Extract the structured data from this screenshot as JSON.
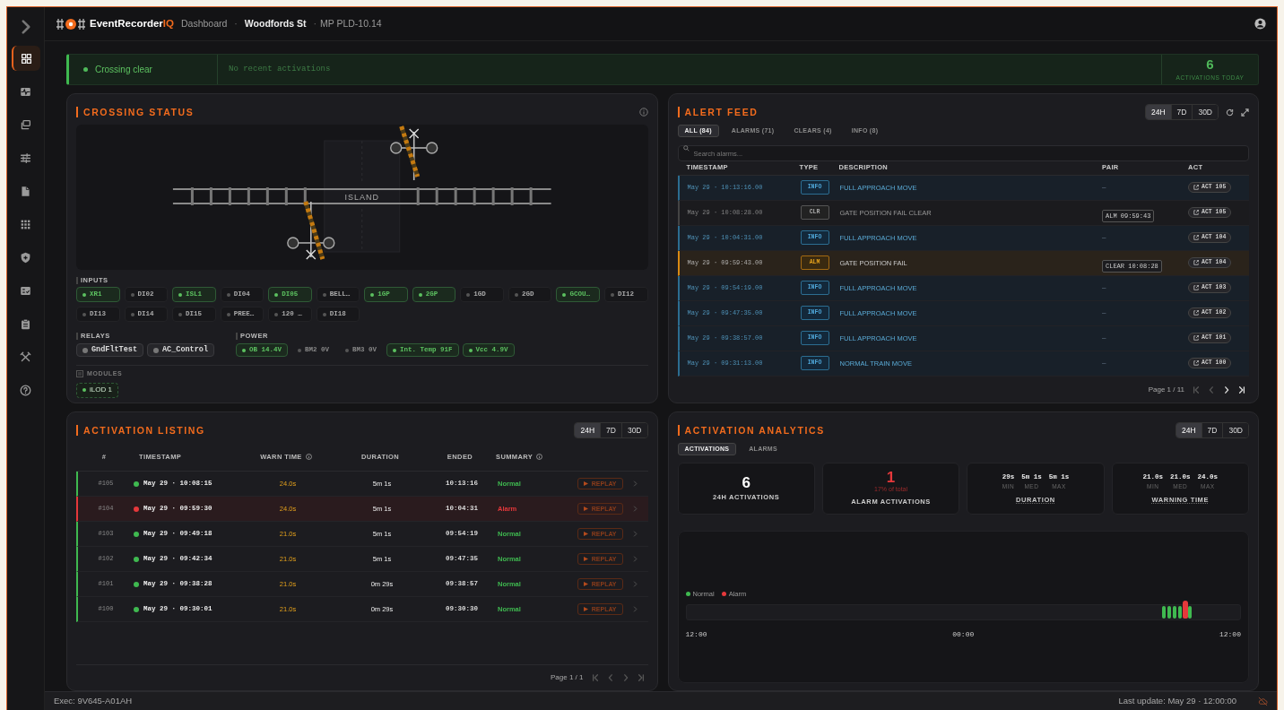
{
  "topbar": {
    "brand": "EventRecorder",
    "brand_accent": "IQ",
    "breadcrumb": [
      {
        "label": "Dashboard",
        "kind": "link"
      },
      {
        "label": "·",
        "kind": "sep"
      },
      {
        "label": "Woodfords St",
        "kind": "strong"
      },
      {
        "label": "·",
        "kind": "sep"
      },
      {
        "label": "MP PLD-10.14",
        "kind": "plain"
      }
    ]
  },
  "sidebar": {
    "items": [
      {
        "selected": true
      },
      {
        "selected": false
      },
      {
        "selected": false
      },
      {
        "selected": false
      },
      {
        "selected": false
      },
      {
        "selected": false
      },
      {
        "selected": false
      },
      {
        "selected": false
      },
      {
        "selected": false
      },
      {
        "selected": false
      },
      {
        "selected": false
      }
    ]
  },
  "status": {
    "state": "Crossing clear",
    "ok": true,
    "message": "No recent activations",
    "count": "6",
    "count_label": "ACTIVATIONS TODAY"
  },
  "crossing": {
    "title": "CROSSING STATUS",
    "island_label": "ISLAND",
    "inputs_title": "INPUTS",
    "inputs": [
      {
        "label": "XR1",
        "on": true
      },
      {
        "label": "DI02",
        "on": false
      },
      {
        "label": "ISL1",
        "on": true
      },
      {
        "label": "DI04",
        "on": false
      },
      {
        "label": "DI05",
        "on": true
      },
      {
        "label": "BELL…",
        "on": false
      },
      {
        "label": "1GP",
        "on": true
      },
      {
        "label": "2GP",
        "on": true
      },
      {
        "label": "1GD",
        "on": false
      },
      {
        "label": "2GD",
        "on": false
      },
      {
        "label": "GCOU…",
        "on": true
      },
      {
        "label": "DI12",
        "on": false
      },
      {
        "label": "DI13",
        "on": false
      },
      {
        "label": "DI14",
        "on": false
      },
      {
        "label": "DI15",
        "on": false
      },
      {
        "label": "PREE…",
        "on": false
      },
      {
        "label": "120 …",
        "on": false
      },
      {
        "label": "DI18",
        "on": false
      }
    ],
    "relays_title": "RELAYS",
    "relays": [
      {
        "label": "GndFltTest",
        "on": false
      },
      {
        "label": "AC_Control",
        "on": false
      }
    ],
    "power_title": "POWER",
    "power": [
      {
        "label": "OB 14.4V",
        "on": true
      },
      {
        "label": "BM2 0V",
        "on": false
      },
      {
        "label": "BM3 0V",
        "on": false
      },
      {
        "label": "Int. Temp 91F",
        "on": true
      },
      {
        "label": "Vcc 4.9V",
        "on": true
      }
    ],
    "modules_title": "MODULES",
    "modules": [
      {
        "label": "iLOD 1",
        "on": true
      }
    ]
  },
  "alerts": {
    "title": "ALERT FEED",
    "ranges": [
      {
        "label": "24H",
        "selected": true
      },
      {
        "label": "7D",
        "selected": false
      },
      {
        "label": "30D",
        "selected": false
      }
    ],
    "tabs": [
      {
        "label": "ALL (84)",
        "selected": true
      },
      {
        "label": "ALARMS (71)",
        "selected": false
      },
      {
        "label": "CLEARS (4)",
        "selected": false
      },
      {
        "label": "INFO (8)",
        "selected": false
      }
    ],
    "search": {
      "placeholder": "Search alarms..."
    },
    "columns": [
      "TIMESTAMP",
      "TYPE",
      "DESCRIPTION",
      "PAIR",
      "ACT"
    ],
    "rows": [
      {
        "timestamp": "May 29 · 10:13:16.00",
        "type": "INFO",
        "kind": "info",
        "description": "FULL APPROACH MOVE",
        "pair": "–",
        "act": "ACT 105"
      },
      {
        "timestamp": "May 29 · 10:08:28.00",
        "type": "CLR",
        "kind": "clr",
        "description": "GATE POSITION FAIL CLEAR",
        "pair": "ALM 09:59:43",
        "act": "ACT 105"
      },
      {
        "timestamp": "May 29 · 10:04:31.00",
        "type": "INFO",
        "kind": "info",
        "description": "FULL APPROACH MOVE",
        "pair": "–",
        "act": "ACT 104"
      },
      {
        "timestamp": "May 29 · 09:59:43.00",
        "type": "ALM",
        "kind": "alm",
        "description": "GATE POSITION FAIL",
        "pair": "CLEAR 10:08:28",
        "act": "ACT 104"
      },
      {
        "timestamp": "May 29 · 09:54:19.00",
        "type": "INFO",
        "kind": "info",
        "description": "FULL APPROACH MOVE",
        "pair": "–",
        "act": "ACT 103"
      },
      {
        "timestamp": "May 29 · 09:47:35.00",
        "type": "INFO",
        "kind": "info",
        "description": "FULL APPROACH MOVE",
        "pair": "–",
        "act": "ACT 102"
      },
      {
        "timestamp": "May 29 · 09:38:57.00",
        "type": "INFO",
        "kind": "info",
        "description": "FULL APPROACH MOVE",
        "pair": "–",
        "act": "ACT 101"
      },
      {
        "timestamp": "May 29 · 09:31:13.00",
        "type": "INFO",
        "kind": "info",
        "description": "NORMAL TRAIN MOVE",
        "pair": "–",
        "act": "ACT 100"
      }
    ],
    "pager": {
      "label": "Page 1 / 11",
      "buttons": [
        {
          "disabled": true
        },
        {
          "disabled": true
        },
        {
          "disabled": false
        },
        {
          "disabled": false
        }
      ]
    }
  },
  "activations": {
    "title": "ACTIVATION LISTING",
    "ranges": [
      {
        "label": "24H",
        "selected": true
      },
      {
        "label": "7D",
        "selected": false
      },
      {
        "label": "30D",
        "selected": false
      }
    ],
    "columns": [
      {
        "label": "#",
        "info": false
      },
      {
        "label": "TIMESTAMP",
        "info": false
      },
      {
        "label": "WARN TIME",
        "info": true
      },
      {
        "label": "DURATION",
        "info": false
      },
      {
        "label": "ENDED",
        "info": false
      },
      {
        "label": "SUMMARY",
        "info": true
      }
    ],
    "rows": [
      {
        "num": "#105",
        "kind": "normal",
        "timestamp": "May 29 · 10:08:15",
        "warn": "24.0s",
        "duration": "5m 1s",
        "ended": "10:13:16",
        "summary": "Normal",
        "replay": "REPLAY"
      },
      {
        "num": "#104",
        "kind": "alarm",
        "timestamp": "May 29 · 09:59:30",
        "warn": "24.0s",
        "duration": "5m 1s",
        "ended": "10:04:31",
        "summary": "Alarm",
        "replay": "REPLAY"
      },
      {
        "num": "#103",
        "kind": "normal",
        "timestamp": "May 29 · 09:49:18",
        "warn": "21.0s",
        "duration": "5m 1s",
        "ended": "09:54:19",
        "summary": "Normal",
        "replay": "REPLAY"
      },
      {
        "num": "#102",
        "kind": "normal",
        "timestamp": "May 29 · 09:42:34",
        "warn": "21.0s",
        "duration": "5m 1s",
        "ended": "09:47:35",
        "summary": "Normal",
        "replay": "REPLAY"
      },
      {
        "num": "#101",
        "kind": "normal",
        "timestamp": "May 29 · 09:38:28",
        "warn": "21.0s",
        "duration": "0m 29s",
        "ended": "09:38:57",
        "summary": "Normal",
        "replay": "REPLAY"
      },
      {
        "num": "#100",
        "kind": "normal",
        "timestamp": "May 29 · 09:30:01",
        "warn": "21.0s",
        "duration": "0m 29s",
        "ended": "09:30:30",
        "summary": "Normal",
        "replay": "REPLAY"
      }
    ],
    "pager": {
      "label": "Page 1 / 1",
      "buttons": [
        {
          "disabled": true
        },
        {
          "disabled": true
        },
        {
          "disabled": true
        },
        {
          "disabled": true
        }
      ]
    }
  },
  "analytics": {
    "title": "ACTIVATION ANALYTICS",
    "ranges": [
      {
        "label": "24H",
        "selected": true
      },
      {
        "label": "7D",
        "selected": false
      },
      {
        "label": "30D",
        "selected": false
      }
    ],
    "tabs": [
      {
        "label": "ACTIVATIONS",
        "selected": true
      },
      {
        "label": "ALARMS",
        "selected": false
      }
    ],
    "stats": [
      {
        "kind": "single",
        "value": "6",
        "label": "24H ACTIVATIONS"
      },
      {
        "kind": "alarm",
        "value": "1",
        "sub": "17% of total",
        "label": "ALARM ACTIVATIONS"
      },
      {
        "kind": "triple",
        "parts": [
          {
            "value": "29s",
            "label": "MIN"
          },
          {
            "value": "5m 1s",
            "label": "MED"
          },
          {
            "value": "5m 1s",
            "label": "MAX"
          }
        ],
        "label": "DURATION"
      },
      {
        "kind": "triple",
        "parts": [
          {
            "value": "21.0s",
            "label": "MIN"
          },
          {
            "value": "21.0s",
            "label": "MED"
          },
          {
            "value": "24.0s",
            "label": "MAX"
          }
        ],
        "label": "WARNING TIME"
      }
    ],
    "legend": [
      {
        "label": "Normal",
        "color": "#3fb950"
      },
      {
        "label": "Alarm",
        "color": "#e5383b"
      }
    ],
    "ticks": [
      "12:00",
      "00:00",
      "12:00"
    ]
  },
  "footer": {
    "exec": "Exec: 9V645-A01AH",
    "last_update": "Last update: May 29 · 12:00:00"
  }
}
